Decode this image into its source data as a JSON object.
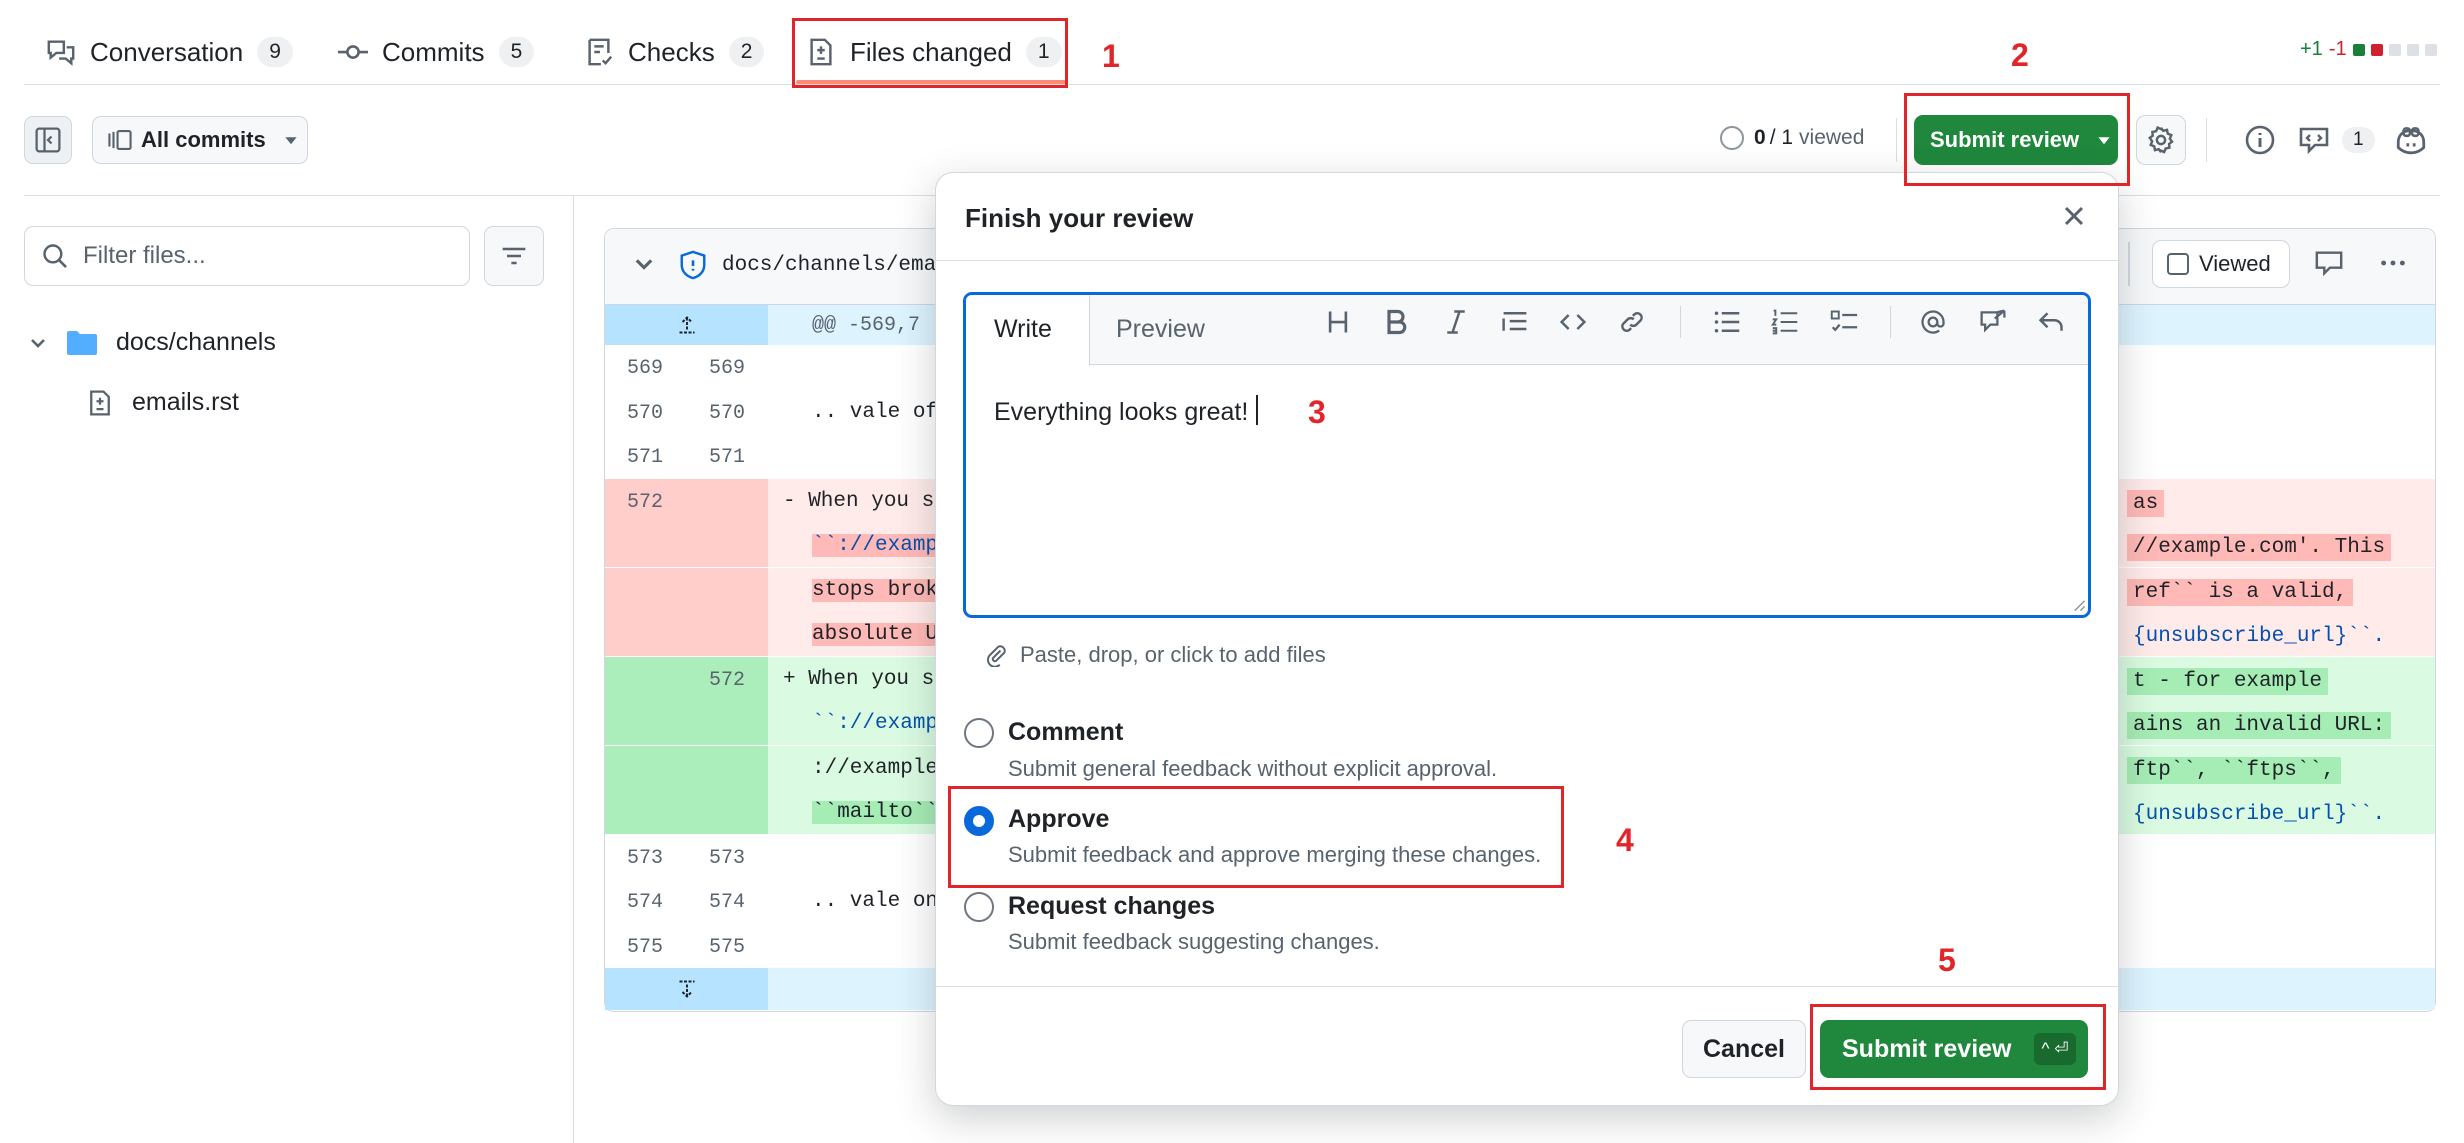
{
  "tabs": [
    {
      "label": "Conversation",
      "count": "9"
    },
    {
      "label": "Commits",
      "count": "5"
    },
    {
      "label": "Checks",
      "count": "2"
    },
    {
      "label": "Files changed",
      "count": "1"
    }
  ],
  "diffstat": {
    "added": "+1",
    "removed": "-1",
    "add_color": "#1a7f37",
    "del_color": "#cf222e"
  },
  "toolbar": {
    "all_commits": "All commits",
    "viewed_count": "0",
    "viewed_total": "/ 1",
    "viewed_label": "viewed",
    "submit_review": "Submit review",
    "comments_count": "1"
  },
  "sidebar": {
    "filter_placeholder": "Filter files...",
    "folder": "docs/channels",
    "file": "emails.rst"
  },
  "file_header": {
    "path": "docs/channels/emai",
    "viewed_label": "Viewed"
  },
  "diff": {
    "hunk": "@@ -569,7",
    "rows": [
      {
        "old": "569",
        "new": "569",
        "left": "",
        "right": ""
      },
      {
        "old": "570",
        "new": "570",
        "left": ".. vale of",
        "right": ""
      },
      {
        "old": "571",
        "new": "571",
        "left": "",
        "right": ""
      },
      {
        "old": "572",
        "new": "",
        "left": "- When you s",
        "right": "as"
      },
      {
        "old": "",
        "new": "",
        "left": "``://examp",
        "right": "//example.com'. This"
      },
      {
        "old": "",
        "new": "",
        "left": "stops brok",
        "right": "ref`` is a valid,"
      },
      {
        "old": "",
        "new": "",
        "left": "absolute U",
        "right": "{unsubscribe_url}``."
      },
      {
        "old": "",
        "new": "572",
        "left": "+ When you s",
        "right": "t - for example"
      },
      {
        "old": "",
        "new": "",
        "left": "``://examp",
        "right": "ains an invalid URL:"
      },
      {
        "old": "",
        "new": "",
        "left": "://example",
        "right": "ftp``, ``ftps``,"
      },
      {
        "old": "",
        "new": "",
        "left": "``mailto``",
        "right": "{unsubscribe_url}``."
      },
      {
        "old": "573",
        "new": "573",
        "left": "",
        "right": ""
      },
      {
        "old": "574",
        "new": "574",
        "left": ".. vale on",
        "right": ""
      },
      {
        "old": "575",
        "new": "575",
        "left": "",
        "right": ""
      }
    ]
  },
  "modal": {
    "title": "Finish your review",
    "write_tab": "Write",
    "preview_tab": "Preview",
    "body_text": "Everything looks great!",
    "attach_hint": "Paste, drop, or click to add files",
    "options": [
      {
        "label": "Comment",
        "desc": "Submit general feedback without explicit approval.",
        "selected": false
      },
      {
        "label": "Approve",
        "desc": "Submit feedback and approve merging these changes.",
        "selected": true
      },
      {
        "label": "Request changes",
        "desc": "Submit feedback suggesting changes.",
        "selected": false
      }
    ],
    "cancel": "Cancel",
    "submit": "Submit review",
    "shortcut": "^ ⏎"
  },
  "annotations": [
    "1",
    "2",
    "3",
    "4",
    "5"
  ],
  "colors": {
    "primary_green": "#1f883d",
    "focus_blue": "#0969da",
    "annotation_red": "#e0262a"
  }
}
